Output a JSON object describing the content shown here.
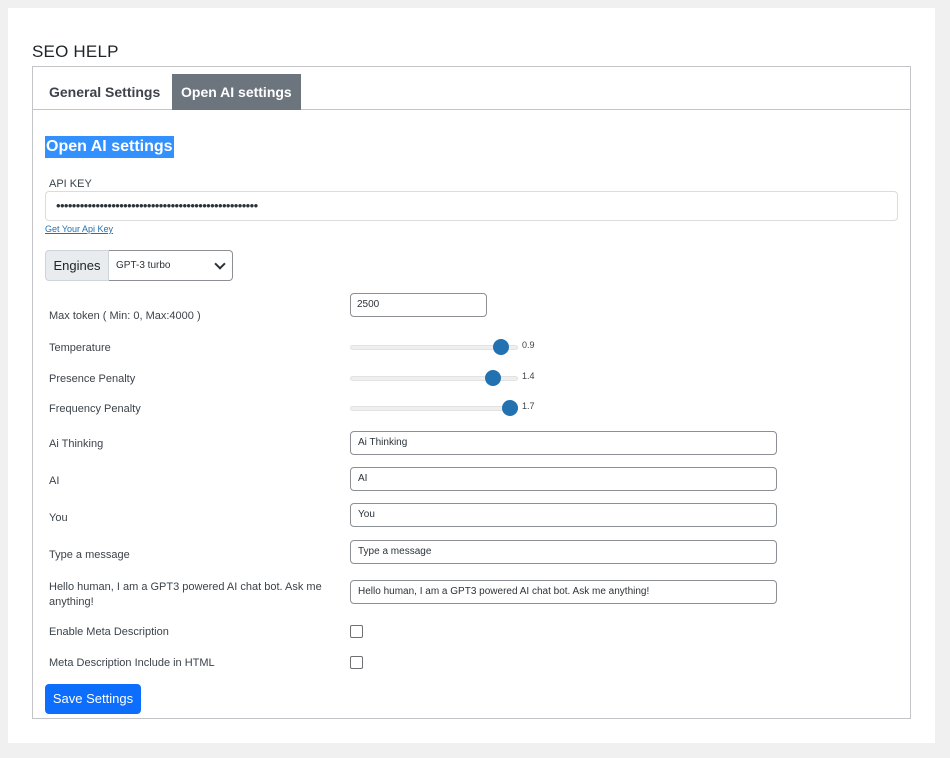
{
  "page": {
    "title": "SEO HELP"
  },
  "tabs": [
    {
      "label": "General Settings",
      "active": false
    },
    {
      "label": "Open AI settings",
      "active": true
    }
  ],
  "section": {
    "title": "Open AI settings"
  },
  "api": {
    "label": "API KEY",
    "value": "•••••••••••••••••••••••••••••••••••••••••••••••••••",
    "link": "Get Your Api Key"
  },
  "engines": {
    "label": "Engines",
    "selected": "GPT-3 turbo"
  },
  "max_token": {
    "label": "Max token ( Min: 0, Max:4000 )",
    "value": "2500"
  },
  "sliders": [
    {
      "label": "Temperature",
      "value": "0.9",
      "level": 0.9
    },
    {
      "label": "Presence Penalty",
      "value": "1.4",
      "level": 0.85
    },
    {
      "label": "Frequency Penalty",
      "value": "1.7",
      "level": 0.95
    }
  ],
  "fields": [
    {
      "label": "Ai Thinking",
      "value": "Ai Thinking"
    },
    {
      "label": "AI",
      "value": "AI"
    },
    {
      "label": "You",
      "value": "You"
    },
    {
      "label": "Type a message",
      "value": "Type a message"
    },
    {
      "label": "Hello human, I am a GPT3 powered AI chat bot. Ask me anything!",
      "value": "Hello human, I am a GPT3 powered AI chat bot. Ask me anything!"
    }
  ],
  "checkboxes": [
    {
      "label": "Enable Meta Description",
      "checked": false
    },
    {
      "label": "Meta Description Include in HTML",
      "checked": false
    }
  ],
  "save": {
    "label": "Save Settings"
  },
  "colors": {
    "primary": "#0d6efd",
    "tab_active": "#6c757d",
    "slider": "#2271b1",
    "highlight": "#3390ff"
  }
}
